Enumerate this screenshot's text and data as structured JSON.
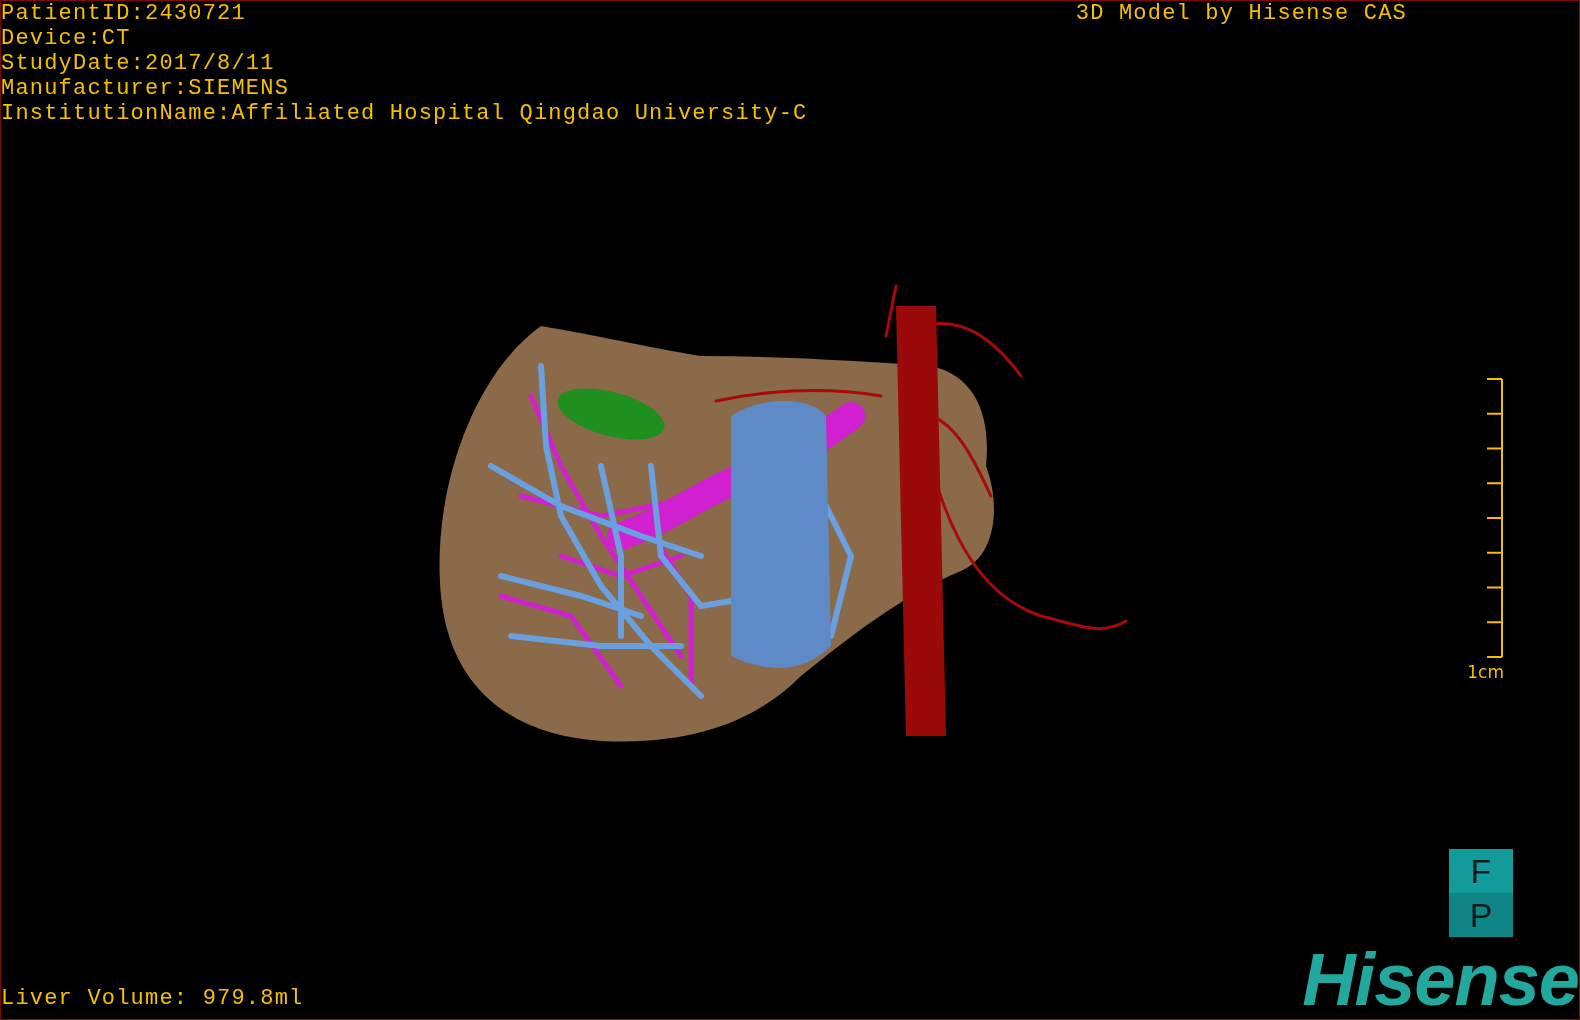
{
  "header_lines": [
    "PatientID:2430721",
    "Device:CT",
    "StudyDate:2017/8/11",
    "Manufacturer:SIEMENS",
    "InstitutionName:Affiliated Hospital Qingdao University-C"
  ],
  "title": "3D Model by Hisense CAS",
  "scale": {
    "label": "1cm"
  },
  "orientation": {
    "top": "F",
    "bottom": "P"
  },
  "volume": "Liver Volume: 979.8ml",
  "logo": "Hisense"
}
